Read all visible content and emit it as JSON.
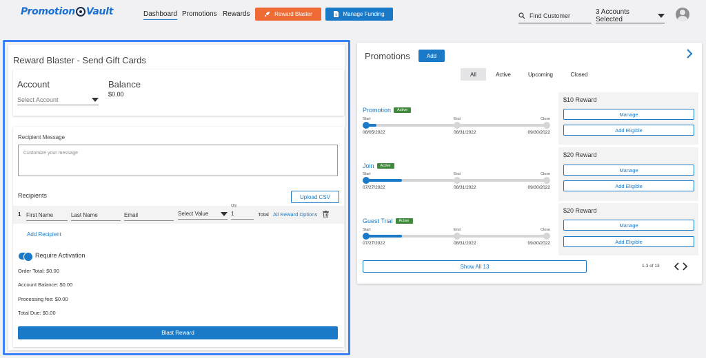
{
  "header": {
    "logo_part1": "Promotion",
    "logo_part2": "Vault",
    "nav": [
      "Dashboard",
      "Promotions",
      "Rewards"
    ],
    "reward_blaster_label": "Reward Blaster",
    "manage_funding_label": "Manage Funding",
    "search_placeholder": "Find Customer",
    "accounts_selected": "3 Accounts Selected"
  },
  "reward_blaster": {
    "title": "Reward Blaster - Send Gift Cards",
    "account_label": "Account",
    "account_placeholder": "Select Account",
    "balance_label": "Balance",
    "balance_value": "$0.00",
    "recipient_message_label": "Recipient Message",
    "message_placeholder": "Customize your message",
    "recipients_label": "Recipients",
    "upload_csv_label": "Upload CSV",
    "row": {
      "index": "1",
      "first_name": "First Name",
      "last_name": "Last Name",
      "email": "Email",
      "select_value": "Select Value",
      "qty_label": "Qty",
      "qty_value": "1",
      "total_label": "Total",
      "all_reward_options": "All Reward Options"
    },
    "add_recipient_label": "Add Recipient",
    "require_activation_label": "Require Activation",
    "order_total": "Order Total: $0.00",
    "account_balance": "Account Balance: $0.00",
    "processing_fee": "Processing fee: $0.00",
    "total_due": "Total Due: $0.00",
    "blast_reward_label": "Blast Reward"
  },
  "promotions": {
    "title": "Promotions",
    "add_label": "Add",
    "tabs": [
      "All",
      "Active",
      "Upcoming",
      "Closed"
    ],
    "timeline_labels": {
      "start": "Start",
      "end": "End",
      "close": "Close"
    },
    "items": [
      {
        "name": "Promotion",
        "status": "Active",
        "start": "08/05/2022",
        "end": "08/31/2022",
        "close": "09/30/2022",
        "progress": 0.06,
        "reward": "$10 Reward",
        "manage": "Manage",
        "add_eligible": "Add Eligible"
      },
      {
        "name": "Join",
        "status": "Active",
        "start": "07/27/2022",
        "end": "08/31/2022",
        "close": "09/30/2022",
        "progress": 0.2,
        "reward": "$20 Reward",
        "manage": "Manage",
        "add_eligible": "Add Eligible"
      },
      {
        "name": "Guest Trial",
        "status": "Active",
        "start": "07/27/2022",
        "end": "08/31/2022",
        "close": "09/30/2022",
        "progress": 0.2,
        "reward": "$20 Reward",
        "manage": "Manage",
        "add_eligible": "Add Eligible"
      }
    ],
    "show_all_label": "Show All 13",
    "pager_text": "1-3 of 13"
  },
  "colors": {
    "accent": "#1a7ac8",
    "orange": "#ef6b35",
    "active_badge": "#3f8a3a",
    "focus_border": "#3b82f6"
  }
}
